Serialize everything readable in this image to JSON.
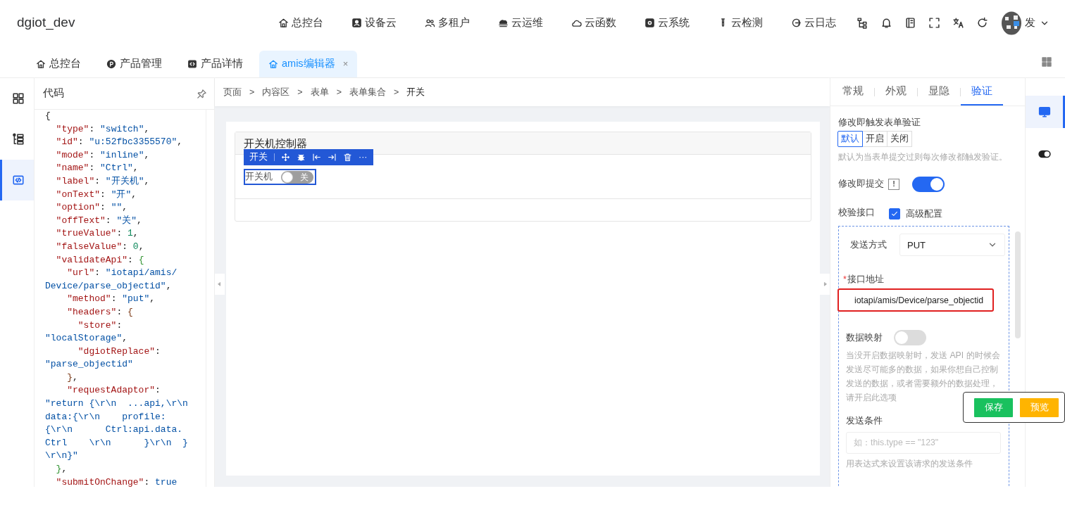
{
  "header": {
    "brand": "dgiot_dev",
    "menu": [
      {
        "label": "总控台"
      },
      {
        "label": "设备云"
      },
      {
        "label": "多租户"
      },
      {
        "label": "云运维"
      },
      {
        "label": "云函数"
      },
      {
        "label": "云系统"
      },
      {
        "label": "云检测"
      },
      {
        "label": "云日志"
      }
    ],
    "user": {
      "name": "发"
    }
  },
  "tabs": [
    {
      "label": "总控台",
      "selected": false
    },
    {
      "label": "产品管理",
      "selected": false
    },
    {
      "label": "产品详情",
      "selected": false
    },
    {
      "label": "amis编辑器",
      "selected": true,
      "close": "×"
    }
  ],
  "left_rail": [
    {
      "selected": false
    },
    {
      "selected": false
    },
    {
      "selected": true
    }
  ],
  "code_panel": {
    "title": "代码",
    "lines": [
      [
        {
          "kind": "punct",
          "text": "{"
        }
      ],
      [
        {
          "kind": "key",
          "text": "  \"type\""
        },
        {
          "kind": "punct",
          "text": ": "
        },
        {
          "kind": "string",
          "text": "\"switch\""
        },
        {
          "kind": "punct",
          "text": ","
        }
      ],
      [
        {
          "kind": "key",
          "text": "  \"id\""
        },
        {
          "kind": "punct",
          "text": ": "
        },
        {
          "kind": "string",
          "text": "\"u:52fbc3355570\""
        },
        {
          "kind": "punct",
          "text": ","
        }
      ],
      [
        {
          "kind": "key",
          "text": "  \"mode\""
        },
        {
          "kind": "punct",
          "text": ": "
        },
        {
          "kind": "string",
          "text": "\"inline\""
        },
        {
          "kind": "punct",
          "text": ","
        }
      ],
      [
        {
          "kind": "key",
          "text": "  \"name\""
        },
        {
          "kind": "punct",
          "text": ": "
        },
        {
          "kind": "string",
          "text": "\"Ctrl\""
        },
        {
          "kind": "punct",
          "text": ","
        }
      ],
      [
        {
          "kind": "key",
          "text": "  \"label\""
        },
        {
          "kind": "punct",
          "text": ": "
        },
        {
          "kind": "string",
          "text": "\"开关机\""
        },
        {
          "kind": "punct",
          "text": ","
        }
      ],
      [
        {
          "kind": "key",
          "text": "  \"onText\""
        },
        {
          "kind": "punct",
          "text": ": "
        },
        {
          "kind": "string",
          "text": "\"开\""
        },
        {
          "kind": "punct",
          "text": ","
        }
      ],
      [
        {
          "kind": "key",
          "text": "  \"option\""
        },
        {
          "kind": "punct",
          "text": ": "
        },
        {
          "kind": "string",
          "text": "\"\""
        },
        {
          "kind": "punct",
          "text": ","
        }
      ],
      [
        {
          "kind": "key",
          "text": "  \"offText\""
        },
        {
          "kind": "punct",
          "text": ": "
        },
        {
          "kind": "string",
          "text": "\"关\""
        },
        {
          "kind": "punct",
          "text": ","
        }
      ],
      [
        {
          "kind": "key",
          "text": "  \"trueValue\""
        },
        {
          "kind": "punct",
          "text": ": "
        },
        {
          "kind": "number",
          "text": "1"
        },
        {
          "kind": "punct",
          "text": ","
        }
      ],
      [
        {
          "kind": "key",
          "text": "  \"falseValue\""
        },
        {
          "kind": "punct",
          "text": ": "
        },
        {
          "kind": "number",
          "text": "0"
        },
        {
          "kind": "punct",
          "text": ","
        }
      ],
      [
        {
          "kind": "key",
          "text": "  \"validateApi\""
        },
        {
          "kind": "punct",
          "text": ": "
        },
        {
          "kind": "brace",
          "text": "{"
        }
      ],
      [
        {
          "kind": "key",
          "text": "    \"url\""
        },
        {
          "kind": "punct",
          "text": ": "
        },
        {
          "kind": "string",
          "text": "\"iotapi/amis/"
        }
      ],
      [
        {
          "kind": "string",
          "text": "Device/parse_objectid\""
        },
        {
          "kind": "punct",
          "text": ","
        }
      ],
      [
        {
          "kind": "key",
          "text": "    \"method\""
        },
        {
          "kind": "punct",
          "text": ": "
        },
        {
          "kind": "string",
          "text": "\"put\""
        },
        {
          "kind": "punct",
          "text": ","
        }
      ],
      [
        {
          "kind": "key",
          "text": "    \"headers\""
        },
        {
          "kind": "punct",
          "text": ": "
        },
        {
          "kind": "brace2",
          "text": "{"
        }
      ],
      [
        {
          "kind": "key",
          "text": "      \"store\""
        },
        {
          "kind": "punct",
          "text": ":"
        }
      ],
      [
        {
          "kind": "string",
          "text": "\"localStorage\""
        },
        {
          "kind": "punct",
          "text": ","
        }
      ],
      [
        {
          "kind": "key",
          "text": "      \"dgiotReplace\""
        },
        {
          "kind": "punct",
          "text": ":"
        }
      ],
      [
        {
          "kind": "string",
          "text": "\"parse_objectid\""
        }
      ],
      [
        {
          "kind": "brace2",
          "text": "    }"
        },
        {
          "kind": "punct",
          "text": ","
        }
      ],
      [
        {
          "kind": "key",
          "text": "    \"requestAdaptor\""
        },
        {
          "kind": "punct",
          "text": ":"
        }
      ],
      [
        {
          "kind": "string",
          "text": "\"return {\\r\\n  ...api,\\r\\n"
        }
      ],
      [
        {
          "kind": "string",
          "text": "data:{\\r\\n    profile:"
        }
      ],
      [
        {
          "kind": "string",
          "text": "{\\r\\n      Ctrl:api.data."
        }
      ],
      [
        {
          "kind": "string",
          "text": "Ctrl    \\r\\n      }\\r\\n  }"
        }
      ],
      [
        {
          "kind": "string",
          "text": "\\r\\n}\""
        }
      ],
      [
        {
          "kind": "brace",
          "text": "  }"
        },
        {
          "kind": "punct",
          "text": ","
        }
      ],
      [
        {
          "kind": "key",
          "text": "  \"submitOnChange\""
        },
        {
          "kind": "punct",
          "text": ": "
        },
        {
          "kind": "string",
          "text": "true"
        }
      ]
    ]
  },
  "breadcrumb": [
    {
      "kind": "crumb",
      "text": "页面"
    },
    {
      "kind": "separator",
      "text": ">"
    },
    {
      "kind": "crumb",
      "text": "内容区"
    },
    {
      "kind": "separator",
      "text": ">"
    },
    {
      "kind": "crumb",
      "text": "表单"
    },
    {
      "kind": "separator",
      "text": ">"
    },
    {
      "kind": "crumb",
      "text": "表单集合"
    },
    {
      "kind": "separator",
      "text": ">"
    },
    {
      "kind": "current",
      "text": "开关"
    }
  ],
  "form": {
    "title": "开关机控制器",
    "toolbar_label": "开关",
    "more": "···",
    "field": {
      "label": "开关机",
      "on": false,
      "off_text": "关"
    }
  },
  "settings": {
    "tabs": [
      {
        "label": "常规",
        "selected": false
      },
      {
        "label": "外观",
        "selected": false
      },
      {
        "label": "显隐",
        "selected": false
      },
      {
        "label": "验证",
        "selected": true
      }
    ],
    "validate_on_change": {
      "label": "修改即触发表单验证",
      "options": [
        {
          "label": "默认",
          "selected": true
        },
        {
          "label": "开启",
          "selected": false
        },
        {
          "label": "关闭",
          "selected": false
        }
      ],
      "hint": "默认为当表单提交过则每次修改都触发验证。"
    },
    "submit_on_change": {
      "label": "修改即提交",
      "info": "!",
      "on": true
    },
    "validate_api": {
      "label": "校验接口",
      "advanced": {
        "label": "高级配置",
        "checked": true
      },
      "method": {
        "label": "发送方式",
        "value": "PUT"
      },
      "url": {
        "required_mark": "*",
        "label": "接口地址",
        "value": "iotapi/amis/Device/parse_objectid",
        "highlighted": true
      },
      "data_mapping": {
        "label": "数据映射",
        "on": false,
        "description": "当没开启数据映射时，发送 API 的时候会发送尽可能多的数据，如果你想自己控制发送的数据，或者需要额外的数据处理，请开启此选项"
      },
      "condition": {
        "label": "发送条件",
        "placeholder": "如：this.type == \"123\"",
        "hint": "用表达式来设置该请求的发送条件"
      }
    }
  },
  "actions": [
    {
      "label": "保存",
      "kind": "primary"
    },
    {
      "label": "预览",
      "kind": "secondary"
    }
  ],
  "right_rail": [
    {
      "selected": true
    },
    {
      "selected": false
    }
  ]
}
